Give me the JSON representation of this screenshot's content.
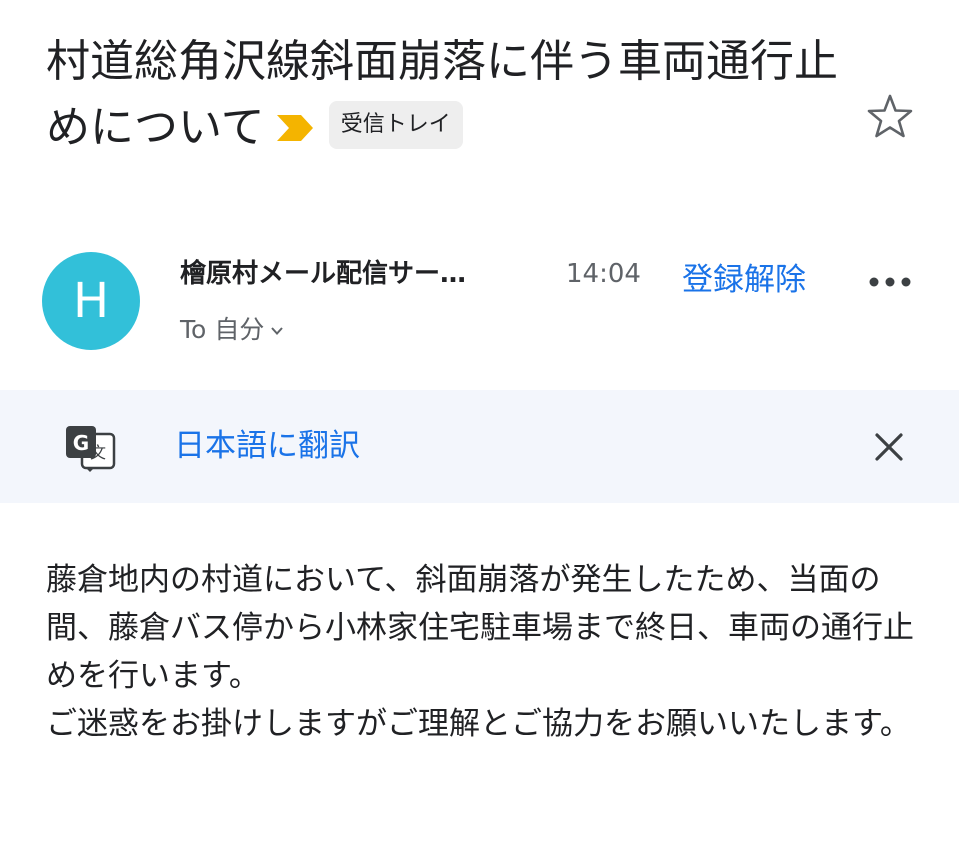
{
  "email": {
    "subject": "村道総角沢線斜面崩落に伴う車両通行止めについて",
    "label": "受信トレイ",
    "sender": {
      "avatar_letter": "H",
      "name": "檜原村メール配信サー…",
      "time": "14:04",
      "unsubscribe_label": "登録解除",
      "to_prefix": "To",
      "to_value": "自分"
    },
    "translate": {
      "link_label": "日本語に翻訳"
    },
    "body": [
      "藤倉地内の村道において、斜面崩落が発生したため、当面の間、藤倉バス停から小林家住宅駐車場まで終日、車両の通行止めを行います。",
      "ご迷惑をお掛けしますがご理解とご協力をお願いいたします。"
    ]
  },
  "icons": {
    "importance": "importance-marker-icon",
    "star": "star-outline-icon",
    "more": "more-horizontal-icon",
    "chevron": "chevron-down-icon",
    "translate": "google-translate-icon",
    "close": "close-icon"
  },
  "colors": {
    "link": "#1a73e8",
    "avatar": "#32c0d9",
    "importance": "#f4b400",
    "translate_bar": "#f3f6fc",
    "label_chip": "#eeeeee"
  }
}
